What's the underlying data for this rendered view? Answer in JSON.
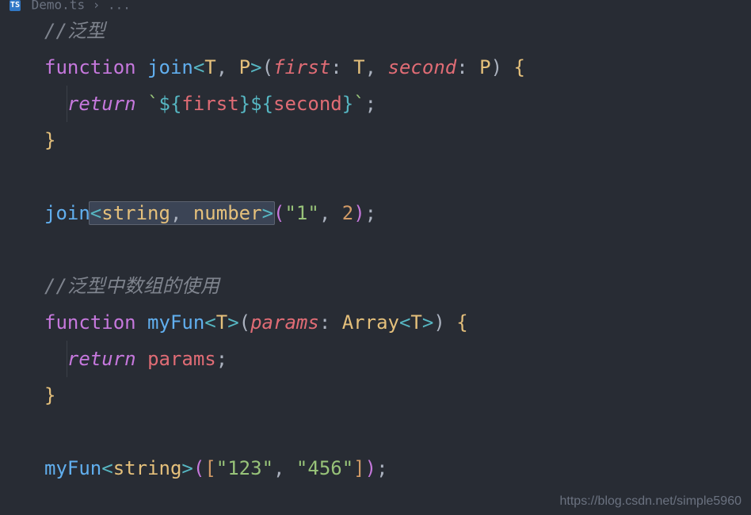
{
  "breadcrumb": {
    "file": "Demo.ts",
    "sep": "›",
    "rest": "..."
  },
  "code": {
    "c1": "//泛型",
    "kw_function": "function",
    "fn_join": "join",
    "lt": "<",
    "gt": ">",
    "T": "T",
    "P": "P",
    "comma": ", ",
    "lparen": "(",
    "rparen": ")",
    "first": "first",
    "colon": ": ",
    "second": "second",
    "lbrace": " {",
    "kw_return": "return",
    "backtick": "`",
    "dollar_open": "${",
    "dollar_close": "}",
    "semi": ";",
    "rbrace": "}",
    "call_join": "join",
    "string_t": "string",
    "number_t": "number",
    "str1": "\"1\"",
    "num2": "2",
    "c2": "//泛型中数组的使用",
    "fn_myFun": "myFun",
    "params": "params",
    "Array": "Array",
    "params_var": "params",
    "call_myFun": "myFun",
    "lbracket": "[",
    "rbracket": "]",
    "str123": "\"123\"",
    "str456": "\"456\""
  },
  "watermark": "https://blog.csdn.net/simple5960"
}
